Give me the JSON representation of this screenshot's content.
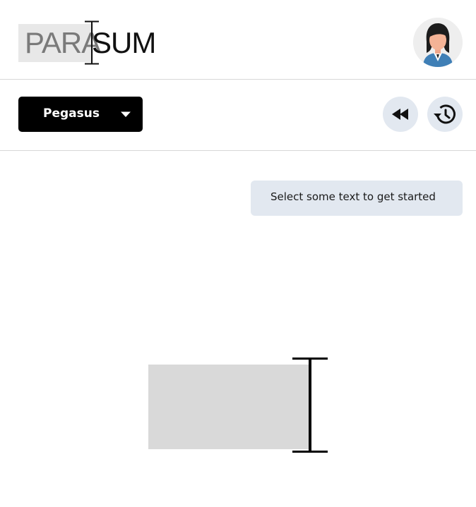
{
  "header": {
    "logo": {
      "part_highlighted": "PARA",
      "part_plain": "SUM"
    },
    "avatar_icon": "user-avatar-icon"
  },
  "toolbar": {
    "model_select": {
      "value": "Pegasus",
      "caret_icon": "caret-down-icon"
    },
    "rewind_icon": "rewind-icon",
    "history_icon": "history-icon"
  },
  "main": {
    "status_text": "Select some text to get started",
    "illustration_icon": "text-cursor-selection-icon"
  },
  "colors": {
    "primary_button_bg": "#000000",
    "icon_button_bg": "#e2e8f0",
    "status_bg": "#e2e8f0",
    "selection_gray": "#d9d9d9",
    "divider": "#d7d7d7"
  }
}
